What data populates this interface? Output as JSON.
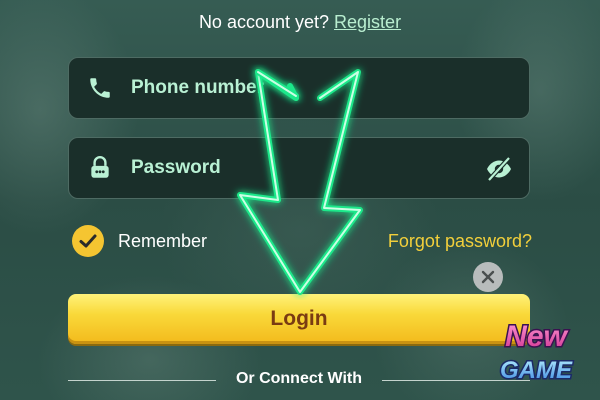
{
  "register": {
    "prompt": "No account yet?",
    "link_label": "Register"
  },
  "phone_field": {
    "placeholder": "Phone number",
    "icon": "phone-icon"
  },
  "password_field": {
    "placeholder": "Password",
    "icon": "lock-icon",
    "toggle_icon": "eye-slash-icon"
  },
  "remember": {
    "label": "Remember",
    "checked": true
  },
  "forgot_password": {
    "label": "Forgot password?"
  },
  "close_button": {
    "icon": "close-icon"
  },
  "login_button": {
    "label": "Login"
  },
  "divider": {
    "label": "Or Connect With"
  },
  "overlay_arrow": {
    "icon": "down-arrow-icon",
    "color": "#1ee88a"
  },
  "logo": {
    "line1": "New",
    "line2": "GAME"
  },
  "colors": {
    "accent_yellow": "#f5c531",
    "field_text": "#b9f1d4",
    "link_green": "#b9eed0",
    "forgot_yellow": "#f2cf3b",
    "login_text": "#7a3b12"
  }
}
